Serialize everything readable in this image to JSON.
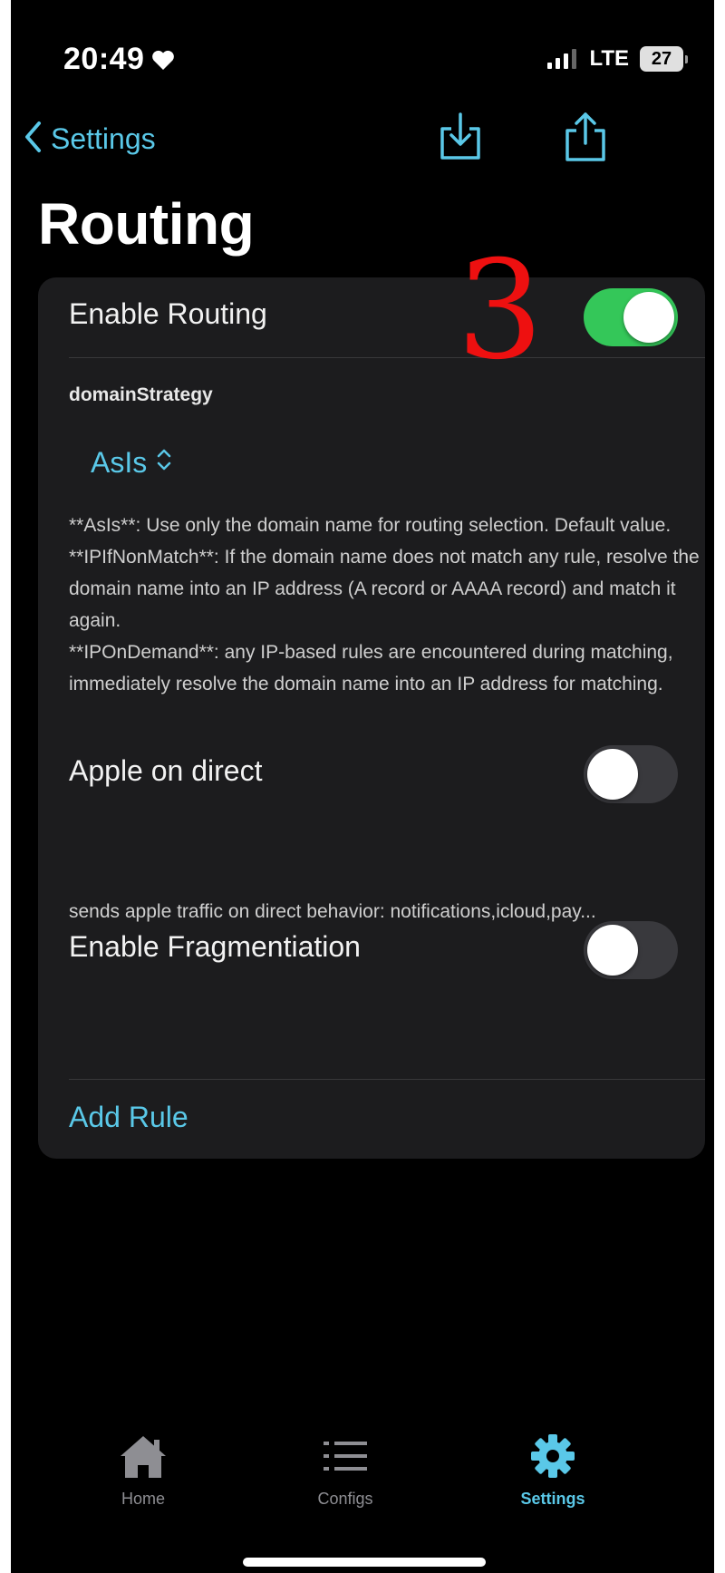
{
  "status_bar": {
    "time": "20:49",
    "network": "LTE",
    "battery": "27"
  },
  "nav": {
    "back_label": "Settings",
    "title": "Routing"
  },
  "annotation": "3",
  "routing": {
    "enable_routing_label": "Enable Routing",
    "enable_routing_on": true,
    "domain_strategy_label": "domainStrategy",
    "domain_strategy_value": "AsIs",
    "description": [
      "**AsIs**: Use only the domain name for routing selection. Default value.",
      "**IPIfNonMatch**: If the domain name does not match any rule, resolve the domain name into an IP address (A record or AAAA record) and match it again.",
      "**IPOnDemand**: any IP-based rules are encountered during matching, immediately resolve the domain name into an IP address for matching."
    ],
    "apple_direct_label": "Apple on direct",
    "apple_direct_on": false,
    "apple_direct_desc": "sends apple traffic on direct behavior: notifications,icloud,pay...",
    "fragmentation_label": "Enable Fragmentiation",
    "fragmentation_on": false,
    "add_rule_label": "Add Rule"
  },
  "tabs": [
    {
      "label": "Home",
      "icon": "home-icon",
      "active": false
    },
    {
      "label": "Configs",
      "icon": "list-icon",
      "active": false
    },
    {
      "label": "Settings",
      "icon": "gear-icon",
      "active": true
    }
  ],
  "colors": {
    "accent": "#5ac8e8",
    "toggle_on": "#34c759",
    "card": "#1c1c1e",
    "annotation": "#ee1010"
  }
}
